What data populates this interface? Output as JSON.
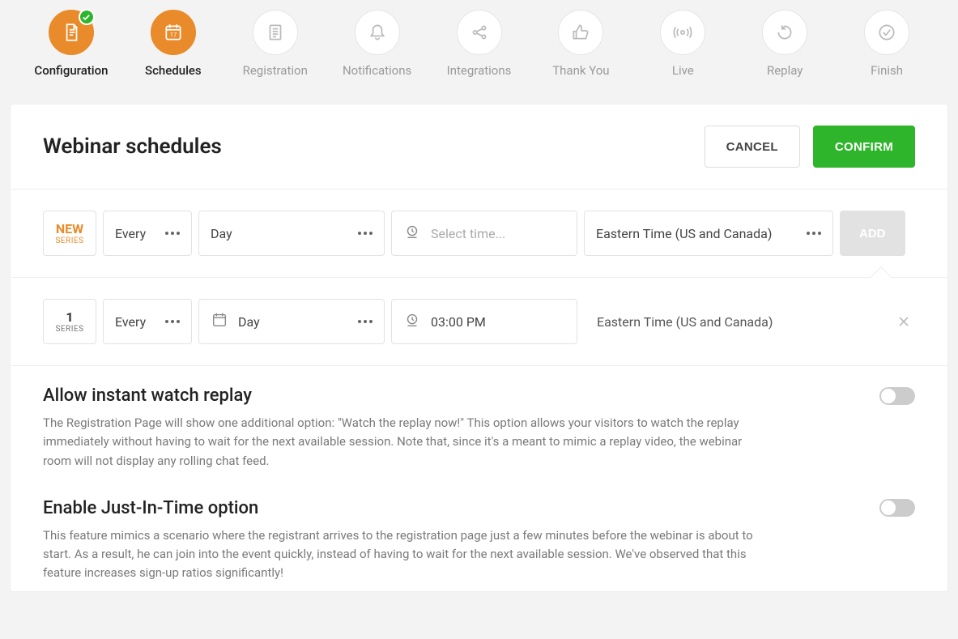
{
  "stepper": [
    {
      "label": "Configuration",
      "icon": "doc",
      "active": true,
      "done": true
    },
    {
      "label": "Schedules",
      "icon": "calendar",
      "active": true,
      "done": false
    },
    {
      "label": "Registration",
      "icon": "list",
      "active": false,
      "done": false
    },
    {
      "label": "Notifications",
      "icon": "bell",
      "active": false,
      "done": false
    },
    {
      "label": "Integrations",
      "icon": "share",
      "active": false,
      "done": false
    },
    {
      "label": "Thank You",
      "icon": "thumb",
      "active": false,
      "done": false
    },
    {
      "label": "Live",
      "icon": "broadcast",
      "active": false,
      "done": false
    },
    {
      "label": "Replay",
      "icon": "undo",
      "active": false,
      "done": false
    },
    {
      "label": "Finish",
      "icon": "check",
      "active": false,
      "done": false
    }
  ],
  "header": {
    "title": "Webinar schedules",
    "cancel": "CANCEL",
    "confirm": "CONFIRM"
  },
  "new_row": {
    "chip_top": "NEW",
    "chip_sub": "SERIES",
    "freq": "Every",
    "unit": "Day",
    "time_placeholder": "Select time...",
    "tz": "Eastern Time (US and Canada)",
    "add": "ADD"
  },
  "series": [
    {
      "chip_top": "1",
      "chip_sub": "SERIES",
      "freq": "Every",
      "unit": "Day",
      "time": "03:00 PM",
      "tz": "Eastern Time (US and Canada)"
    }
  ],
  "options": [
    {
      "title": "Allow instant watch replay",
      "desc": "The Registration Page will show one additional option: \"Watch the replay now!\" This option allows your visitors to watch the replay immediately without having to wait for the next available session. Note that, since it's a meant to mimic a replay video, the webinar room will not display any rolling chat feed.",
      "on": false
    },
    {
      "title": "Enable Just-In-Time option",
      "desc": "This feature mimics a scenario where the registrant arrives to the registration page just a few minutes before the webinar is about to start. As a result, he can join into the event quickly, instead of having to wait for the next available session. We've observed that this feature increases sign-up ratios significantly!",
      "on": false
    }
  ]
}
